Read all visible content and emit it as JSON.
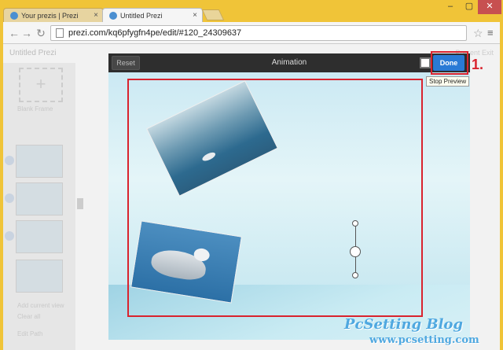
{
  "browser": {
    "tabs": [
      {
        "title": "Your prezis | Prezi",
        "active": false
      },
      {
        "title": "Untitled Prezi",
        "active": true
      }
    ],
    "url": "prezi.com/kq6pfygfn4pe/edit/#120_24309637",
    "close_glyph": "×",
    "window_controls": {
      "minimize": "–",
      "maximize": "▢",
      "close": "✕"
    },
    "nav": {
      "back": "←",
      "forward": "→",
      "reload": "↻"
    },
    "star_glyph": "☆",
    "menu_glyph": "≡"
  },
  "prezi": {
    "title": "Untitled Prezi",
    "toolbar_right": "Present   Exit",
    "sidebar": {
      "add_glyph": "+",
      "frame_label": "Blank Frame",
      "add_current_view": "Add current view",
      "clear_all": "Clear all",
      "edit_path": "Edit Path"
    }
  },
  "animation": {
    "reset_label": "Reset",
    "title": "Animation",
    "done_label": "Done",
    "tooltip": "Stop Preview",
    "step_marker": "1."
  },
  "watermark": {
    "brand": "PcSetting Blog",
    "url": "www.pcsetting.com"
  },
  "colors": {
    "accent_red": "#d9232e",
    "done_blue": "#2a7ad5",
    "chrome_yellow": "#f0c438",
    "watermark_blue": "#4fa8e0"
  }
}
